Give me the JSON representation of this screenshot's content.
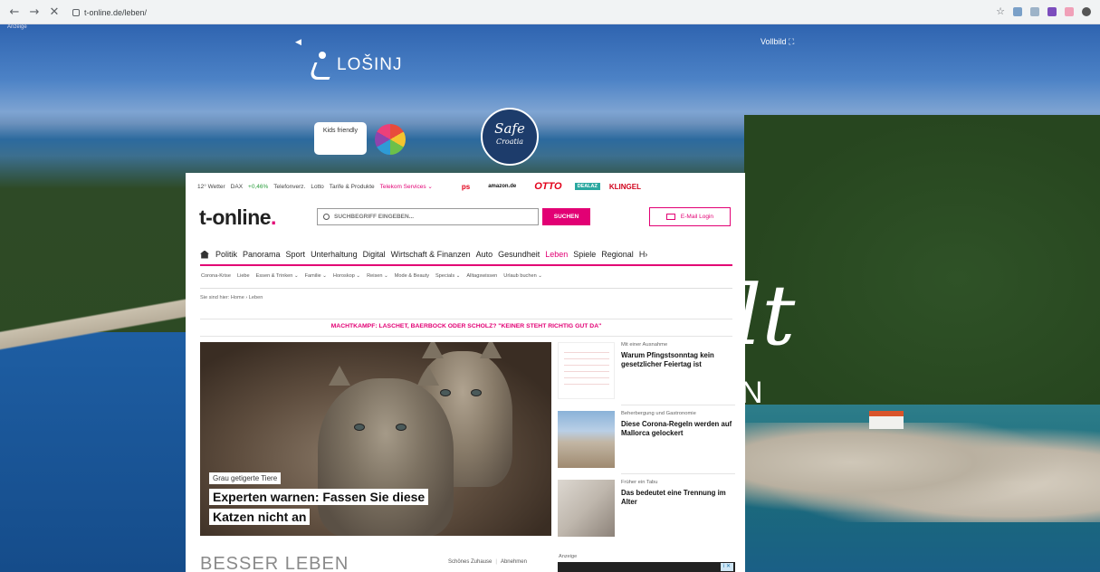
{
  "browser": {
    "url": "t-online.de/leben/",
    "back_glyph": "←",
    "forward_glyph": "→",
    "stop_glyph": "✕",
    "star_glyph": "☆"
  },
  "takeover_ad": {
    "anzeige_label": "Anzeige",
    "prev_arrow": "◀",
    "brand": "LOŠINJ",
    "fullscreen_label": "Vollbild ⛶",
    "kids_badge": "Kids friendly",
    "safe_badge_line1": "Safe",
    "safe_badge_line2": "Croatia",
    "script_text": "lt",
    "script_sub": "N"
  },
  "topbar": {
    "weather": "12° Wetter",
    "dax_label": "DAX",
    "dax_value": "+0,46%",
    "items": [
      "Telefonverz.",
      "Lotto",
      "Tarife & Produkte"
    ],
    "telekom": "Telekom Services ⌄",
    "partners": {
      "ps": "ps",
      "amazon": "amazon.de",
      "otto": "OTTO",
      "deal": "DEALAZ",
      "klingel": "KLINGEL"
    }
  },
  "header": {
    "logo": "t-online",
    "logo_dot": ".",
    "search_placeholder": "SUCHBEGRIFF EINGEBEN...",
    "search_button": "SUCHEN",
    "mail_login": "E-Mail Login"
  },
  "main_nav": [
    "Politik",
    "Panorama",
    "Sport",
    "Unterhaltung",
    "Digital",
    "Wirtschaft & Finanzen",
    "Auto",
    "Gesundheit",
    "Leben",
    "Spiele",
    "Regional",
    "H›"
  ],
  "main_nav_active": "Leben",
  "sub_nav": [
    "Corona-Krise",
    "Liebe",
    "Essen & Trinken ⌄",
    "Familie ⌄",
    "Horoskop ⌄",
    "Reisen ⌄",
    "Mode & Beauty",
    "Specials ⌄",
    "Alltagswissen",
    "Urlaub buchen ⌄"
  ],
  "breadcrumb": "Sie sind hier: Home › Leben",
  "banner_headline": "MACHTKAMPF: LASCHET, BAERBOCK ODER SCHOLZ? \"KEINER STEHT RICHTIG GUT DA\"",
  "hero": {
    "kicker": "Grau getigerte Tiere",
    "title_line1": "Experten warnen: Fassen Sie diese",
    "title_line2": "Katzen nicht an"
  },
  "side_articles": [
    {
      "kicker": "Mit einer Ausnahme",
      "title": "Warum Pfingstsonntag kein gesetzlicher Feiertag ist"
    },
    {
      "kicker": "Beherbergung und Gastronomie",
      "title": "Diese Corona-Regeln werden auf Mallorca gelockert"
    },
    {
      "kicker": "Früher ein Tabu",
      "title": "Das bedeutet eine Trennung im Alter"
    }
  ],
  "footer_section": {
    "title": "BESSER LEBEN",
    "link1": "Schönes Zuhause",
    "link2": "Abnehmen",
    "anzeige": "Anzeige",
    "ad_close": "i ✕"
  },
  "colors": {
    "brand_magenta": "#e20074"
  }
}
